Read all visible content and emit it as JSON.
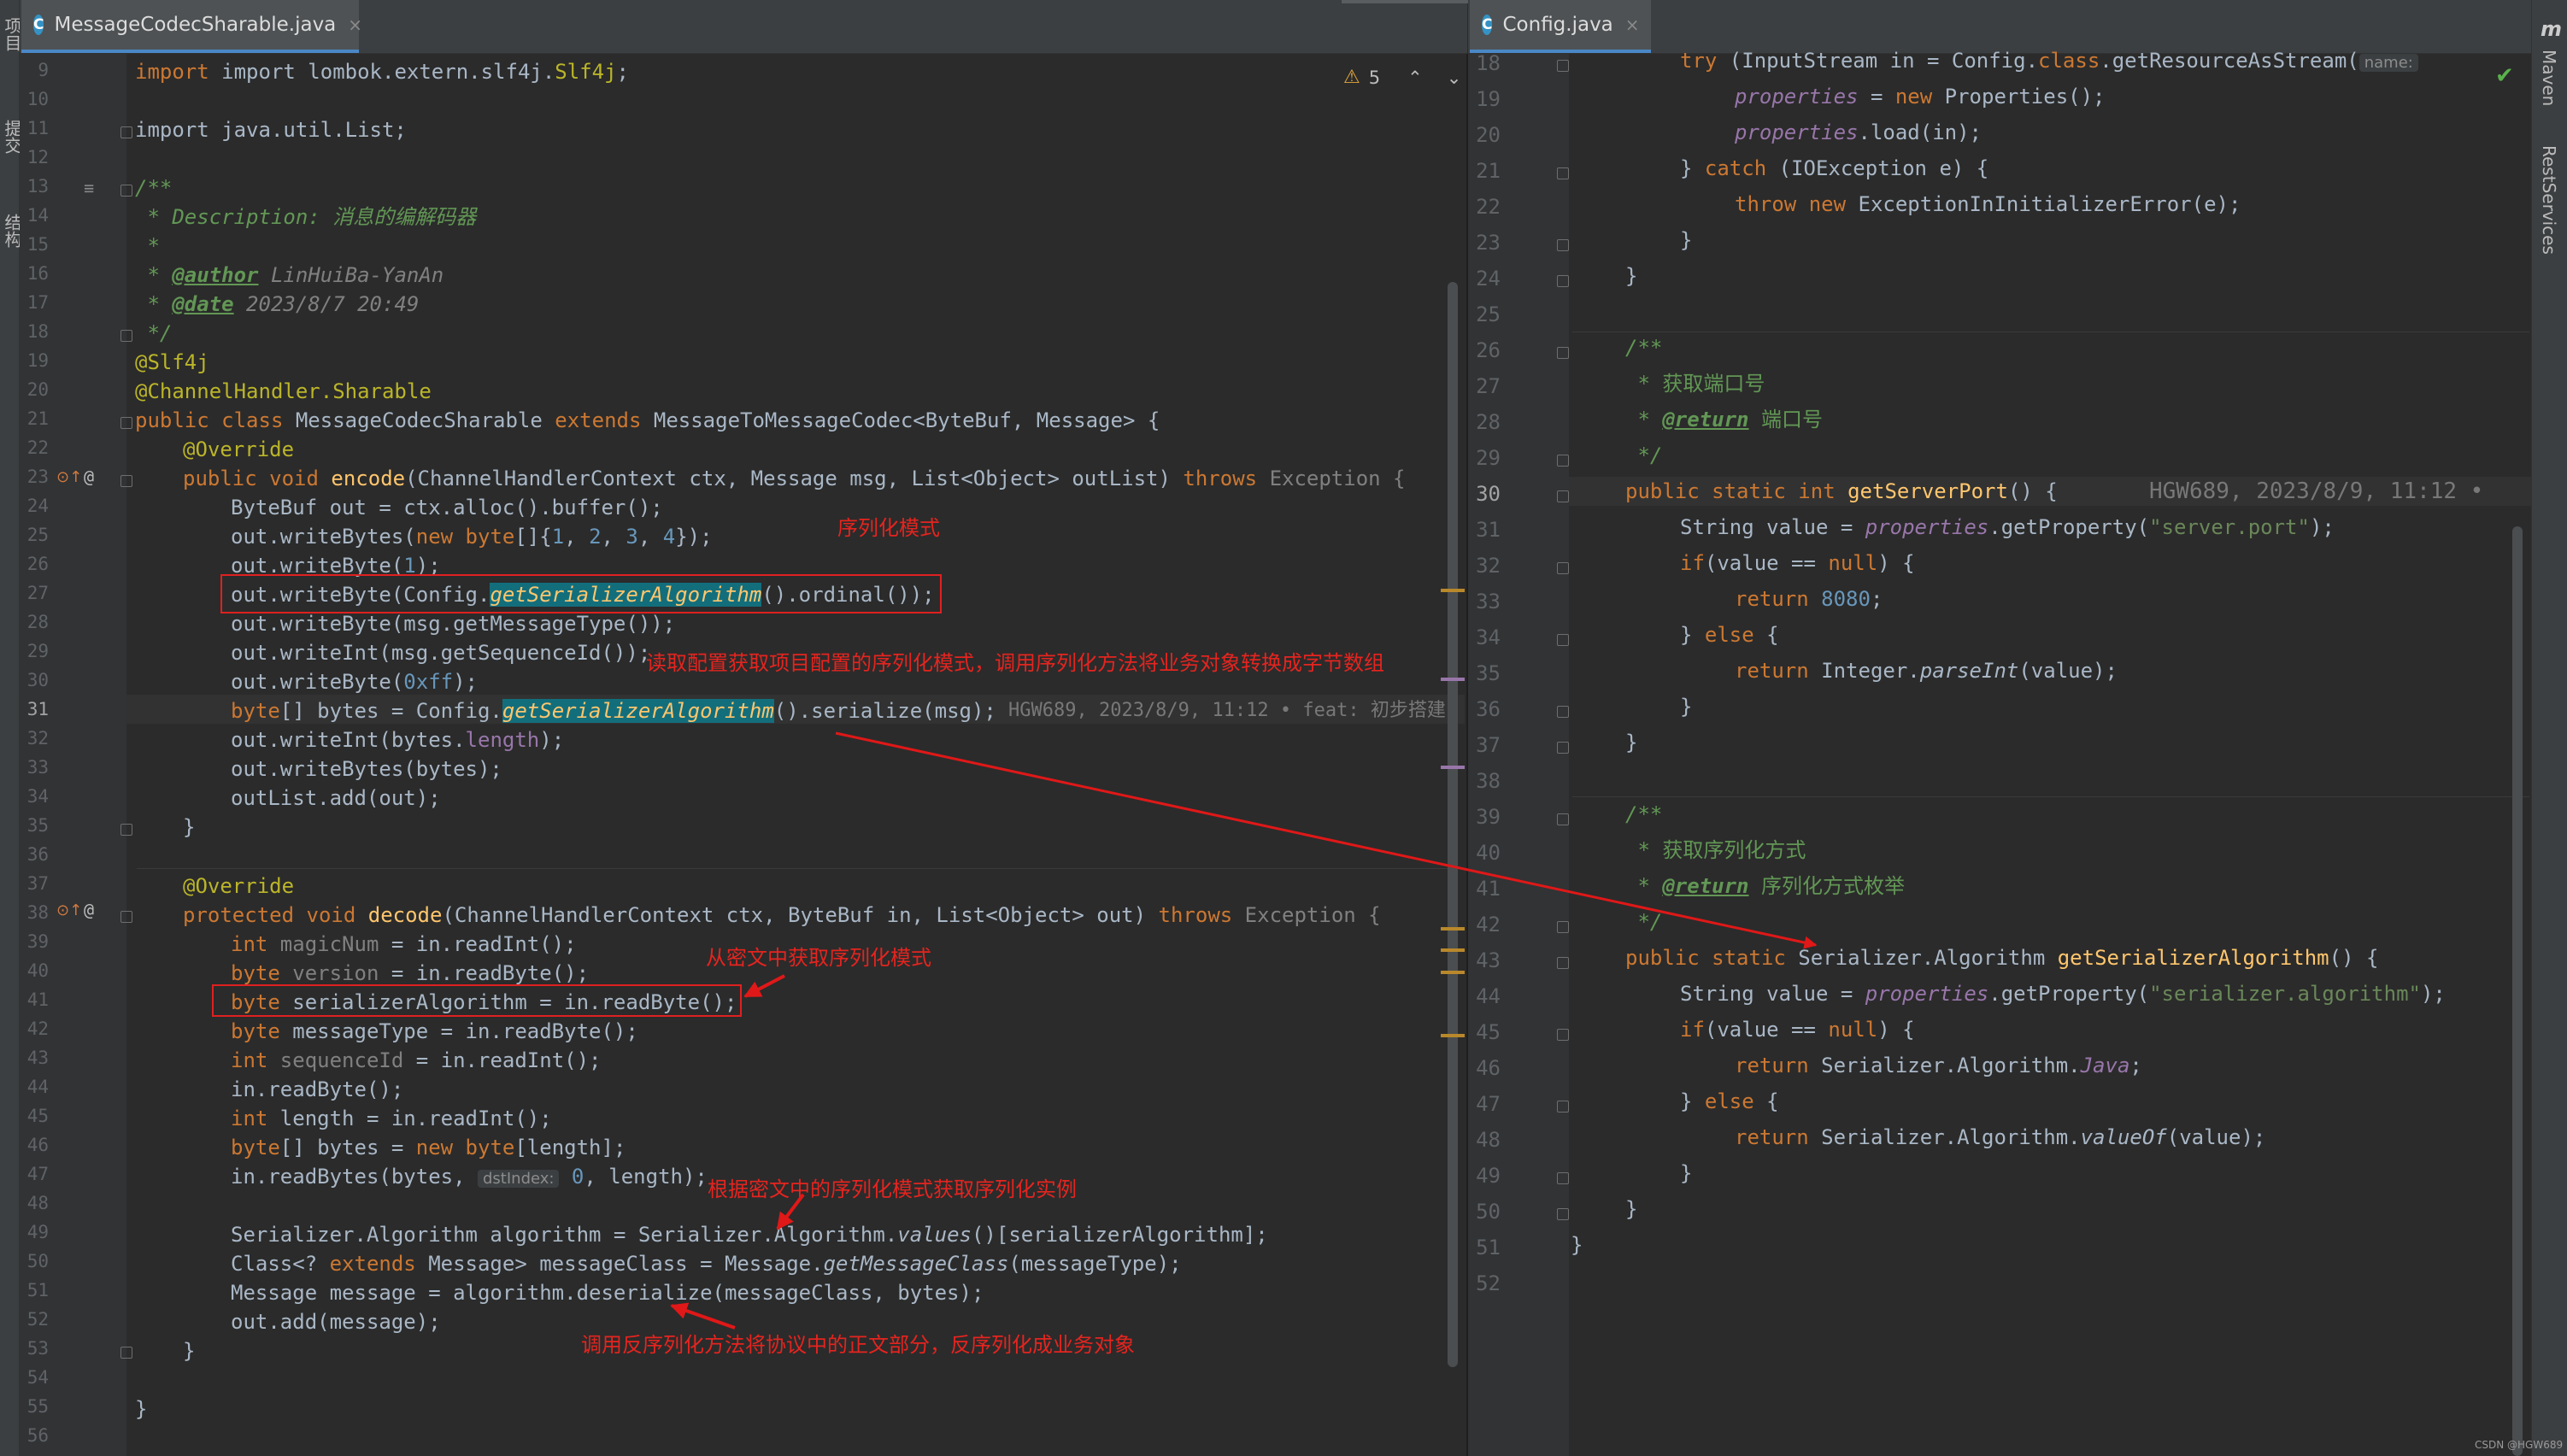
{
  "left_tab": {
    "icon": "C",
    "label": "MessageCodecSharable.java",
    "close": "×"
  },
  "right_tab": {
    "icon": "C",
    "label": "Config.java",
    "close": "×"
  },
  "warnings": {
    "count": "5"
  },
  "left_strip_labels": [
    "项目",
    "提交",
    "结构"
  ],
  "right_strip_labels": [
    "Maven",
    "RestServices"
  ],
  "watermark": "CSDN @HGW689",
  "left_lines": [
    "9",
    "10",
    "11",
    "12",
    "13",
    "14",
    "15",
    "16",
    "17",
    "18",
    "19",
    "20",
    "21",
    "22",
    "23",
    "24",
    "25",
    "26",
    "27",
    "28",
    "29",
    "30",
    "31",
    "32",
    "33",
    "34",
    "35",
    "36",
    "37",
    "38",
    "39",
    "40",
    "41",
    "42",
    "43",
    "44",
    "45",
    "46",
    "47",
    "48",
    "49",
    "50",
    "51",
    "52",
    "53",
    "54",
    "55",
    "56"
  ],
  "right_lines": [
    "18",
    "19",
    "20",
    "21",
    "22",
    "23",
    "24",
    "25",
    "26",
    "27",
    "28",
    "29",
    "30",
    "31",
    "32",
    "33",
    "34",
    "35",
    "36",
    "37",
    "38",
    "39",
    "40",
    "41",
    "42",
    "43",
    "44",
    "45",
    "46",
    "47",
    "48",
    "49",
    "50",
    "51",
    "52"
  ],
  "left_code": {
    "l9": [
      "import lombok.extern.slf4j.",
      "Slf4j",
      ";"
    ],
    "l11": [
      "import java.util.List;"
    ],
    "l13": "/**",
    "l14": [
      " * ",
      "Description:",
      " 消息的编解码器"
    ],
    "l15": " *",
    "l16": [
      " * ",
      "@author",
      " LinHuiBa-YanAn"
    ],
    "l17": [
      " * ",
      "@date",
      " 2023/8/7 20:49"
    ],
    "l18": " */",
    "l19": "@Slf4j",
    "l20": [
      "@ChannelHandler.",
      "Sharable"
    ],
    "l21": [
      "public class ",
      "MessageCodecSharable ",
      "extends ",
      "MessageToMessageCodec<ByteBuf, Message> {"
    ],
    "l22": "@Override",
    "l23": [
      "public void ",
      "encode",
      "(ChannelHandlerContext ctx, Message msg, List<Object> outList) ",
      "throws ",
      "Exception {"
    ],
    "l24": [
      "ByteBuf out = ctx.alloc().buffer();"
    ],
    "l25": [
      "out.writeBytes(",
      "new byte",
      "[]{",
      "1",
      ", ",
      "2",
      ", ",
      "3",
      ", ",
      "4",
      "});"
    ],
    "l26": [
      "out.writeByte(",
      "1",
      ");"
    ],
    "l27": [
      "out.writeByte(Config.",
      "getSerializerAlgorithm",
      "().ordinal());"
    ],
    "l28": [
      "out.writeByte(msg.getMessageType());"
    ],
    "l29": [
      "out.writeInt(msg.getSequenceId());"
    ],
    "l30": [
      "out.writeByte(",
      "0xff",
      ");"
    ],
    "l31": [
      "byte",
      "[] bytes = Config.",
      "getSerializerAlgorithm",
      "().serialize(msg);",
      "HGW689, 2023/8/9, 11:12 • feat: 初步搭建"
    ],
    "l32": [
      "out.writeInt(bytes.",
      "length",
      ");"
    ],
    "l33": [
      "out.writeBytes(bytes);"
    ],
    "l34": [
      "outList.add(out);"
    ],
    "l35": "}",
    "l37": "@Override",
    "l38": [
      "protected void ",
      "decode",
      "(ChannelHandlerContext ctx, ByteBuf in, List<Object> out) ",
      "throws ",
      "Exception {"
    ],
    "l39": [
      "int ",
      "magicNum",
      " = in.readInt();"
    ],
    "l40": [
      "byte ",
      "version",
      " = in.readByte();"
    ],
    "l41": [
      "byte ",
      "serializerAlgorithm = in.readByte();"
    ],
    "l42": [
      "byte ",
      "messageType = in.readByte();"
    ],
    "l43": [
      "int ",
      "sequenceId",
      " = in.readInt();"
    ],
    "l44": [
      "in.readByte();"
    ],
    "l45": [
      "int ",
      "length = in.readInt();"
    ],
    "l46": [
      "byte",
      "[] bytes = ",
      "new byte",
      "[length];"
    ],
    "l47": [
      "in.readBytes(bytes, ",
      "dstIndex:",
      " 0",
      ", length);"
    ],
    "l49": [
      "Serializer.Algorithm algorithm = Serializer.Algorithm.",
      "values",
      "()[serializerAlgorithm];"
    ],
    "l50": [
      "Class<? ",
      "extends ",
      "Message> messageClass = Message.",
      "getMessageClass",
      "(messageType);"
    ],
    "l51": [
      "Message message = algorithm.deserialize(messageClass, bytes);"
    ],
    "l52": [
      "out.add(message);"
    ],
    "l53": "}",
    "l55": "}"
  },
  "right_code": {
    "r18": [
      "try ",
      "(InputStream in = Config.",
      "class",
      ".getResourceAsStream(",
      "name:"
    ],
    "r19": [
      "properties",
      " = ",
      "new ",
      "Properties();"
    ],
    "r20": [
      "properties",
      ".load(in);"
    ],
    "r21": [
      "} ",
      "catch ",
      "(IOException e) {"
    ],
    "r22": [
      "throw new ",
      "ExceptionInInitializerError(e);"
    ],
    "r23": "}",
    "r24": "}",
    "r26": "/**",
    "r27": " * 获取端口号",
    "r28": [
      " * ",
      "@return",
      " 端口号"
    ],
    "r29": " */",
    "r30": [
      "public static int ",
      "getServerPort",
      "() {",
      "HGW689, 2023/8/9, 11:12 •"
    ],
    "r31": [
      "String value = ",
      "properties",
      ".getProperty(",
      "\"server.port\"",
      ");"
    ],
    "r32": [
      "if",
      "(value == ",
      "null",
      ") {"
    ],
    "r33": [
      "return ",
      "8080",
      ";"
    ],
    "r34": [
      "} ",
      "else ",
      "{"
    ],
    "r35": [
      "return ",
      "Integer.",
      "parseInt",
      "(value);"
    ],
    "r36": "}",
    "r37": "}",
    "r39": "/**",
    "r40": " * 获取序列化方式",
    "r41": [
      " * ",
      "@return",
      " 序列化方式枚举"
    ],
    "r42": " */",
    "r43": [
      "public static ",
      "Serializer.Algorithm ",
      "getSerializerAlgorithm",
      "() {"
    ],
    "r44": [
      "String value = ",
      "properties",
      ".getProperty(",
      "\"serializer.algorithm\"",
      ");"
    ],
    "r45": [
      "if",
      "(value == ",
      "null",
      ") {"
    ],
    "r46": [
      "return ",
      "Serializer.Algorithm.",
      "Java",
      ";"
    ],
    "r47": [
      "} ",
      "else ",
      "{"
    ],
    "r48": [
      "return ",
      "Serializer.Algorithm.",
      "valueOf",
      "(value);"
    ],
    "r49": "}",
    "r50": "}",
    "r51": "}"
  },
  "annotations": {
    "serialize_mode": "序列化模式",
    "read_config": "读取配置获取项目配置的序列化模式，调用序列化方法将业务对象转换成字节数组",
    "from_cipher": "从密文中获取序列化模式",
    "get_instance": "根据密文中的序列化模式获取序列化实例",
    "deserialize": "调用反序列化方法将协议中的正文部分，反序列化成业务对象"
  },
  "colors": {
    "annotation": "#e5241f",
    "arrow": "#e01818",
    "match_highlight": "#136e7c"
  }
}
